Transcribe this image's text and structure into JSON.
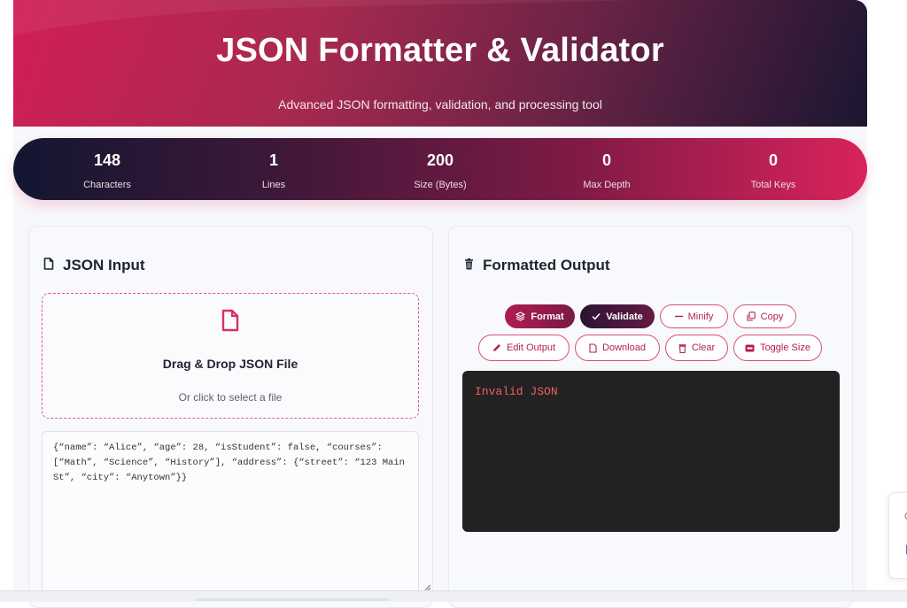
{
  "header": {
    "title": "JSON Formatter & Validator",
    "subtitle": "Advanced JSON formatting, validation, and processing tool"
  },
  "stats": [
    {
      "value": "148",
      "label": "Characters"
    },
    {
      "value": "1",
      "label": "Lines"
    },
    {
      "value": "200",
      "label": "Size (Bytes)"
    },
    {
      "value": "0",
      "label": "Max Depth"
    },
    {
      "value": "0",
      "label": "Total Keys"
    }
  ],
  "input_panel": {
    "title": "JSON Input",
    "icon": "file-icon",
    "dropzone": {
      "title": "Drag & Drop JSON File",
      "subtitle": "Or click to select a file",
      "icon": "file-icon"
    },
    "textarea_value": "{“name”: “Alice”, “age”: 28, “isStudent”: false, “courses”: [“Math”, “Science”, “History”], “address”: {“street”: “123 Main St”, “city”: “Anytown”}}"
  },
  "output_panel": {
    "title": "Formatted Output",
    "icon": "trash-icon",
    "buttons": {
      "format": "Format",
      "validate": "Validate",
      "minify": "Minify",
      "copy": "Copy",
      "edit_output": "Edit Output",
      "download": "Download",
      "clear": "Clear",
      "toggle_size": "Toggle Size"
    },
    "result_text": "Invalid JSON"
  },
  "colors": {
    "accent": "#d11f55",
    "dark": "#1b1631",
    "error_text": "#f0605f",
    "output_bg": "#222222"
  }
}
